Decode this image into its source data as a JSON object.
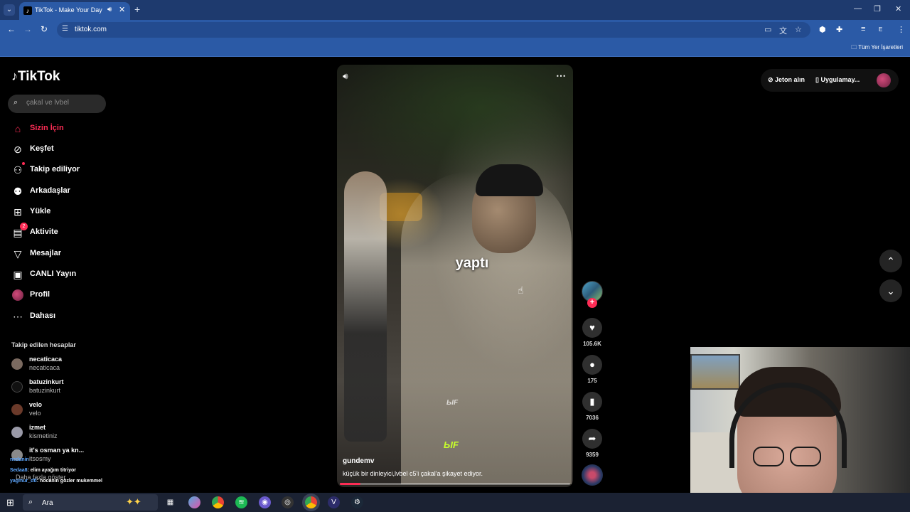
{
  "browser": {
    "tab_title": "TikTok - Make Your Day",
    "url": "tiktok.com",
    "bookmark_folder": "Tüm Yer İşaretleri"
  },
  "tiktok": {
    "logo": "TikTok",
    "search_placeholder": "çakal ve lvbel",
    "nav": [
      {
        "label": "Sizin İçin",
        "icon": "home-icon"
      },
      {
        "label": "Keşfet",
        "icon": "compass-icon"
      },
      {
        "label": "Takip ediliyor",
        "icon": "following-icon"
      },
      {
        "label": "Arkadaşlar",
        "icon": "friends-icon"
      },
      {
        "label": "Yükle",
        "icon": "upload-icon"
      },
      {
        "label": "Aktivite",
        "icon": "activity-icon",
        "badge": "2"
      },
      {
        "label": "Mesajlar",
        "icon": "messages-icon"
      },
      {
        "label": "CANLI Yayın",
        "icon": "live-icon"
      },
      {
        "label": "Profil",
        "icon": "profile-icon"
      },
      {
        "label": "Dahası",
        "icon": "more-icon"
      }
    ],
    "following_title": "Takip edilen hesaplar",
    "following": [
      {
        "username": "necaticaca",
        "name": "necaticaca"
      },
      {
        "username": "batuzinkurt",
        "name": "batuzinkurt"
      },
      {
        "username": "velo",
        "name": "velo"
      },
      {
        "username": "izmet",
        "name": "kismetiniz"
      },
      {
        "username": "it's osman ya kn...",
        "name": "itsosmy"
      }
    ],
    "more_link": "Daha fazla göster",
    "chat": [
      {
        "user": "nedanin",
        "message": ""
      },
      {
        "user": "Sedaa8",
        "message": ": elim ayağım titriyor"
      },
      {
        "user": "yagmur_dtl",
        "message": ": hocanin gözler mukemmel"
      }
    ],
    "top_right": {
      "coins": "Jeton alın",
      "app": "Uygulamay..."
    }
  },
  "video": {
    "caption_overlay": "yaptı",
    "watermark": "ЫF",
    "username": "gundemv",
    "description": "küçük bir dinleyici,lvbel c5'i çakal'a şikayet ediyor.",
    "progress": 0.09,
    "likes": "105.6K",
    "comments": "175",
    "saves": "7036",
    "shares": "9359"
  },
  "taskbar": {
    "search_label": "Ara"
  }
}
